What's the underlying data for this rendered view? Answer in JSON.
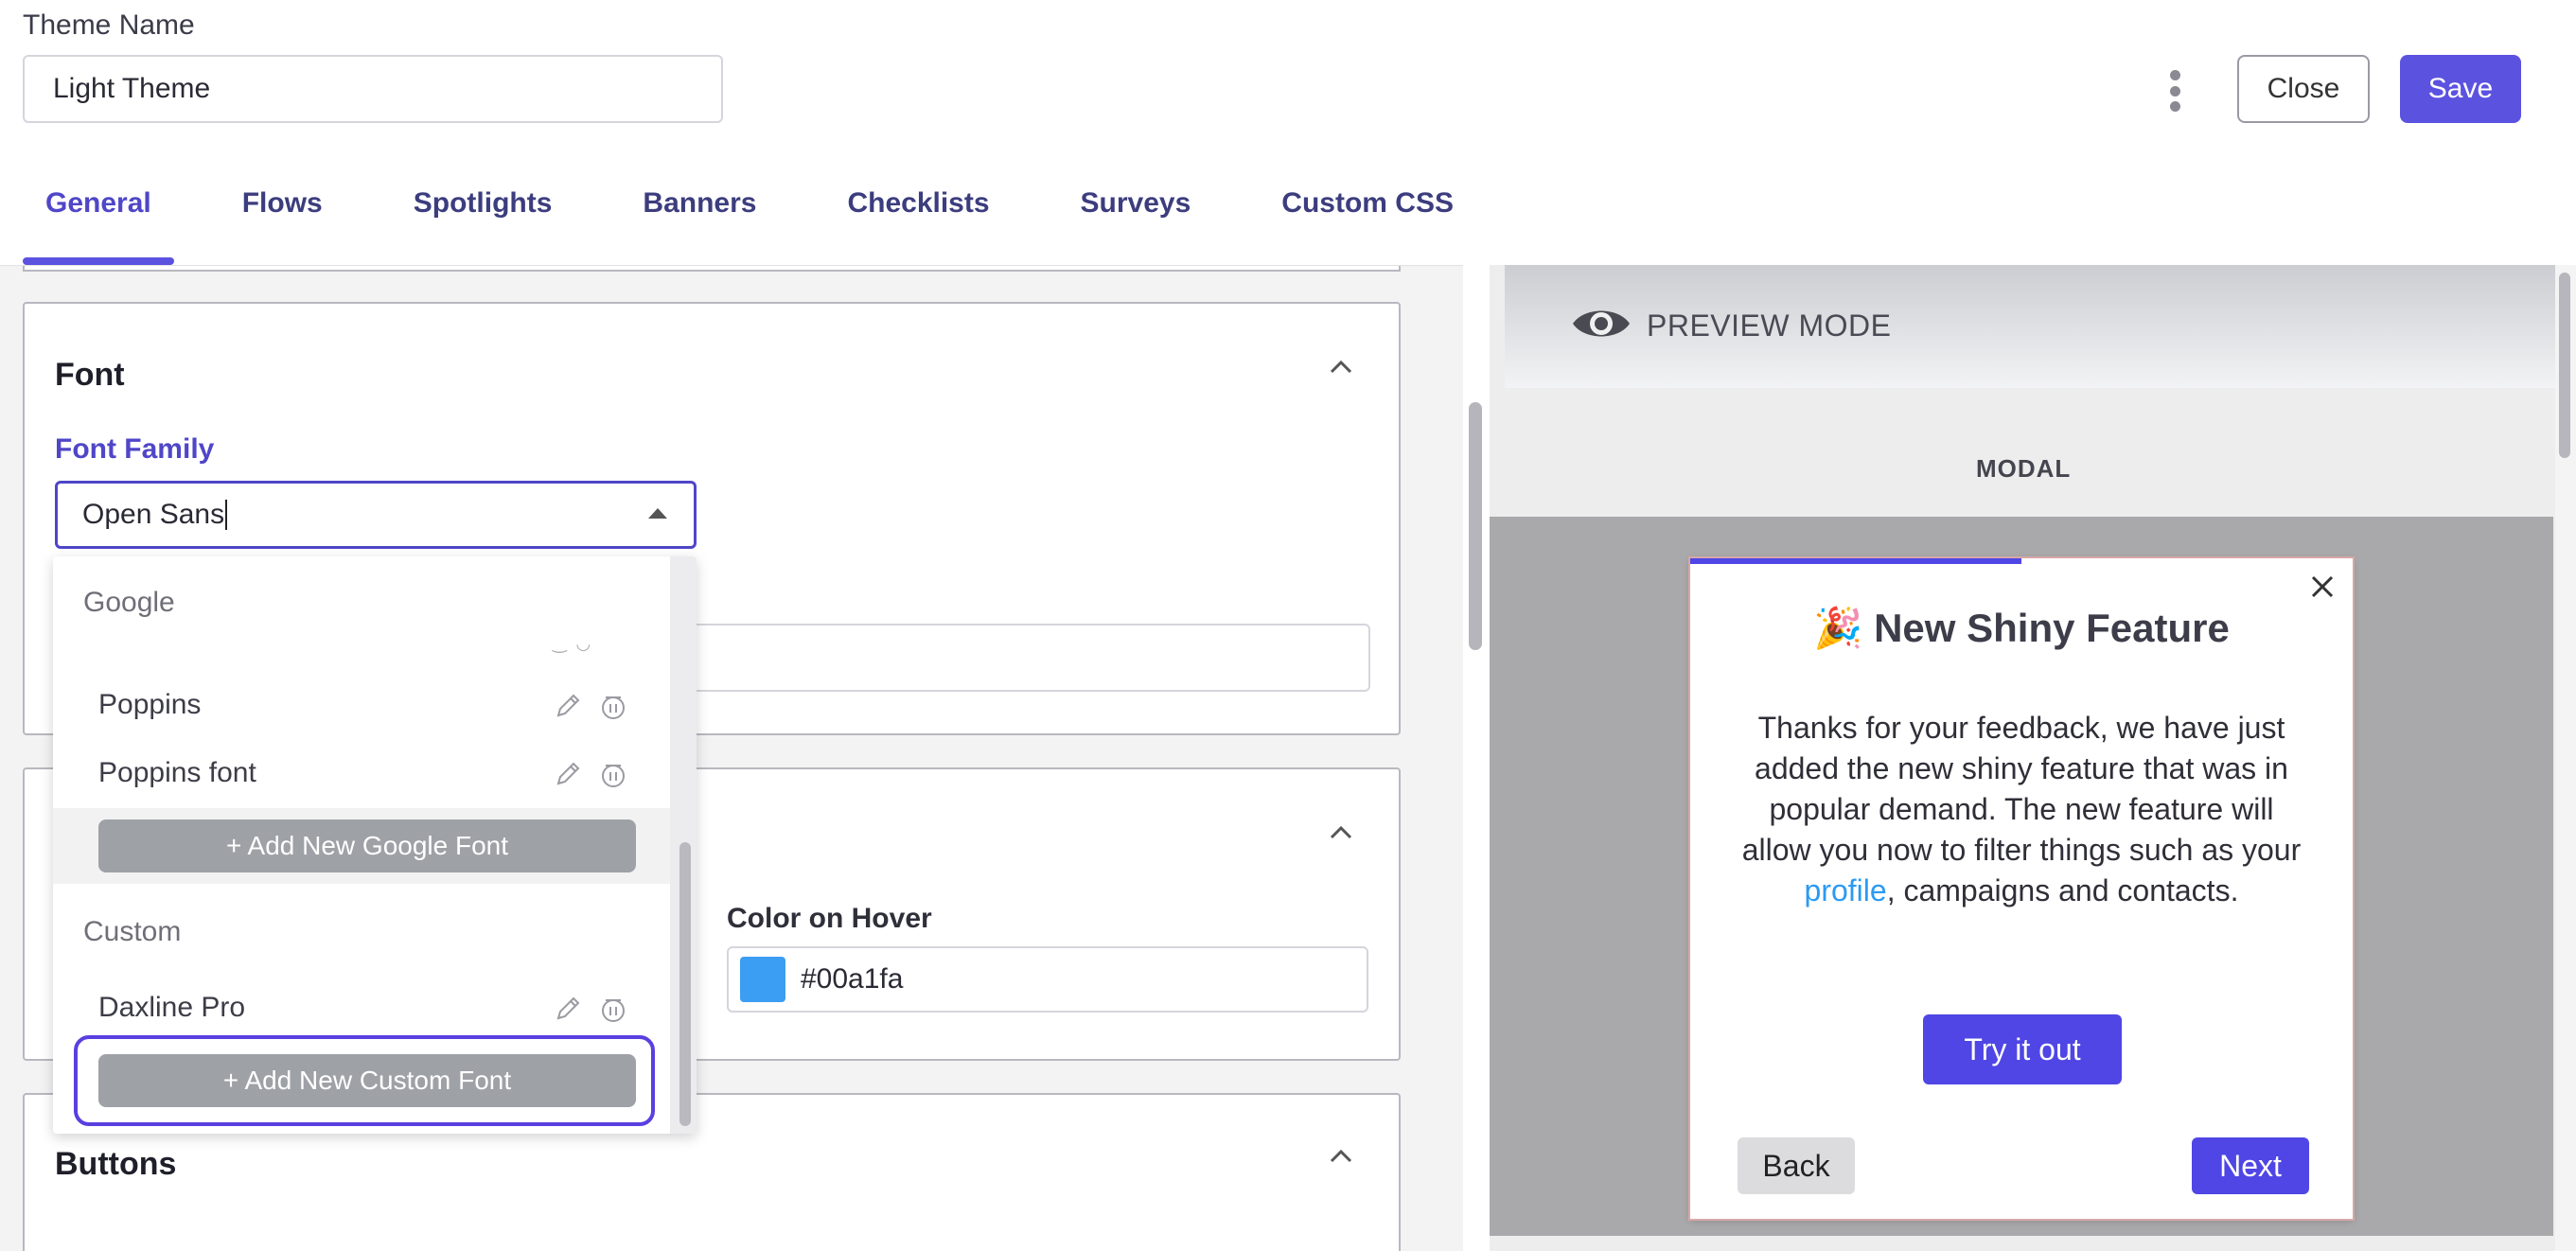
{
  "header": {
    "theme_name_label": "Theme Name",
    "theme_name_value": "Light Theme",
    "more_icon": "kebab-vertical-icon",
    "close_label": "Close",
    "save_label": "Save",
    "accent_color": "#5b52e0"
  },
  "tabs": [
    {
      "label": "General",
      "active": true
    },
    {
      "label": "Flows",
      "active": false
    },
    {
      "label": "Spotlights",
      "active": false
    },
    {
      "label": "Banners",
      "active": false
    },
    {
      "label": "Checklists",
      "active": false
    },
    {
      "label": "Surveys",
      "active": false
    },
    {
      "label": "Custom CSS",
      "active": false
    }
  ],
  "font_section": {
    "title": "Font",
    "font_family_label": "Font Family",
    "font_family_value": "Open Sans",
    "expanded": true
  },
  "dropdown": {
    "groups": [
      {
        "label": "Google",
        "items": [
          "Poppins",
          "Poppins font"
        ],
        "add_button": "+ Add New Google Font"
      },
      {
        "label": "Custom",
        "items": [
          "Daxline Pro"
        ],
        "add_button": "+ Add New Custom Font"
      }
    ],
    "item_icons": [
      "pencil-icon",
      "trash-icon"
    ]
  },
  "links_section": {
    "color_on_hover_label": "Color on Hover",
    "color_on_hover_value": "#00a1fa",
    "swatch_color": "#3c9ef2"
  },
  "buttons_section": {
    "title": "Buttons"
  },
  "preview": {
    "mode_label": "PREVIEW MODE",
    "type_label": "MODAL",
    "modal": {
      "emoji": "🎉",
      "title": "New Shiny Feature",
      "body_before_link": "Thanks for your feedback, we have just added the new shiny feature that was in popular demand. The new feature will allow you now to filter things such as your ",
      "link_text": "profile",
      "body_after_link": ", campaigns and contacts.",
      "cta_label": "Try it out",
      "back_label": "Back",
      "next_label": "Next",
      "progress": 0.5,
      "link_color": "#2b9af3",
      "button_color": "#4f46e5"
    }
  }
}
